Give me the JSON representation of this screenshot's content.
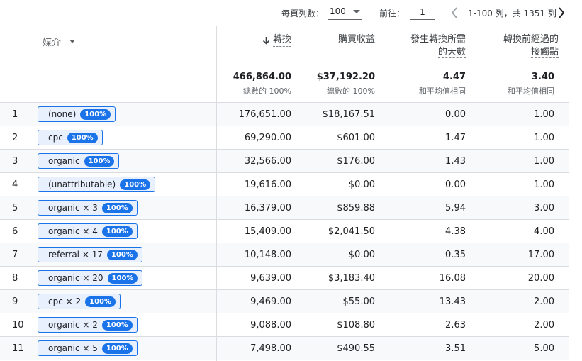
{
  "pager": {
    "rows_per_page_label": "每頁列數：",
    "rows_per_page_value": "100",
    "goto_label": "前往：",
    "goto_value": "1",
    "range_text": "1-100 列，共 1351 列"
  },
  "header": {
    "dimension": "媒介",
    "metrics": [
      {
        "label": "轉換",
        "sorted": "descending"
      },
      {
        "label": "購買收益"
      },
      {
        "label_line1": "發生轉換所需",
        "label_line2": "的天數"
      },
      {
        "label_line1": "轉換前經過的",
        "label_line2": "接觸點"
      }
    ]
  },
  "totals": [
    {
      "value": "466,864.00",
      "sub": "總數的 100%"
    },
    {
      "value": "$37,192.20",
      "sub": "總數的 100%"
    },
    {
      "value": "4.47",
      "sub": "和平均值相同"
    },
    {
      "value": "3.40",
      "sub": "和平均值相同"
    }
  ],
  "rows": [
    {
      "idx": "1",
      "medium": "(none)",
      "pct": "100%",
      "conversions": "176,651.00",
      "revenue": "$18,167.51",
      "days": "0.00",
      "touchpoints": "1.00"
    },
    {
      "idx": "2",
      "medium": "cpc",
      "pct": "100%",
      "conversions": "69,290.00",
      "revenue": "$601.00",
      "days": "1.47",
      "touchpoints": "1.00"
    },
    {
      "idx": "3",
      "medium": "organic",
      "pct": "100%",
      "conversions": "32,566.00",
      "revenue": "$176.00",
      "days": "1.43",
      "touchpoints": "1.00"
    },
    {
      "idx": "4",
      "medium": "(unattributable)",
      "pct": "100%",
      "conversions": "19,616.00",
      "revenue": "$0.00",
      "days": "0.00",
      "touchpoints": "1.00"
    },
    {
      "idx": "5",
      "medium": "organic × 3",
      "pct": "100%",
      "conversions": "16,379.00",
      "revenue": "$859.88",
      "days": "5.94",
      "touchpoints": "3.00"
    },
    {
      "idx": "6",
      "medium": "organic × 4",
      "pct": "100%",
      "conversions": "15,409.00",
      "revenue": "$2,041.50",
      "days": "4.38",
      "touchpoints": "4.00"
    },
    {
      "idx": "7",
      "medium": "referral × 17",
      "pct": "100%",
      "conversions": "10,148.00",
      "revenue": "$0.00",
      "days": "0.35",
      "touchpoints": "17.00"
    },
    {
      "idx": "8",
      "medium": "organic × 20",
      "pct": "100%",
      "conversions": "9,639.00",
      "revenue": "$3,183.40",
      "days": "16.08",
      "touchpoints": "20.00"
    },
    {
      "idx": "9",
      "medium": "cpc × 2",
      "pct": "100%",
      "conversions": "9,469.00",
      "revenue": "$55.00",
      "days": "13.43",
      "touchpoints": "2.00"
    },
    {
      "idx": "10",
      "medium": "organic × 2",
      "pct": "100%",
      "conversions": "9,088.00",
      "revenue": "$108.80",
      "days": "2.63",
      "touchpoints": "2.00"
    },
    {
      "idx": "11",
      "medium": "organic × 5",
      "pct": "100%",
      "conversions": "7,498.00",
      "revenue": "$490.55",
      "days": "3.51",
      "touchpoints": "5.00"
    }
  ]
}
